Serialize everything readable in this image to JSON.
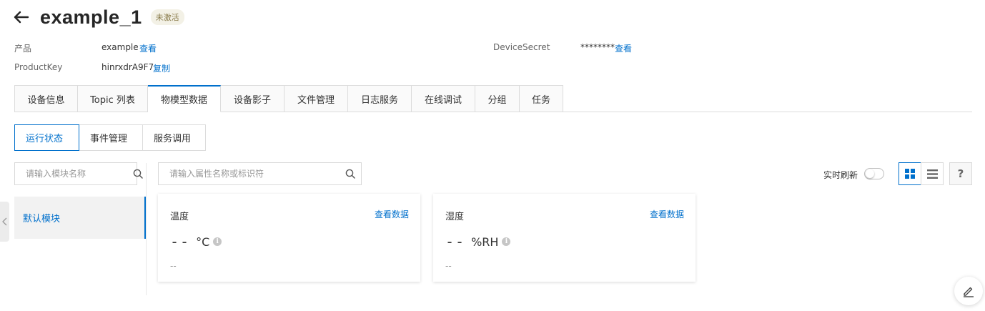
{
  "header": {
    "title": "example_1",
    "status_badge": "未激活"
  },
  "info": {
    "product_label": "产品",
    "product_value": "example",
    "product_link": "查看",
    "productkey_label": "ProductKey",
    "productkey_value": "hinrxdrA9F7",
    "productkey_link": "复制",
    "devicesecret_label": "DeviceSecret",
    "devicesecret_value": "********",
    "devicesecret_link": "查看"
  },
  "main_tabs": [
    {
      "label": "设备信息",
      "active": false
    },
    {
      "label": "Topic 列表",
      "active": false
    },
    {
      "label": "物模型数据",
      "active": true
    },
    {
      "label": "设备影子",
      "active": false
    },
    {
      "label": "文件管理",
      "active": false
    },
    {
      "label": "日志服务",
      "active": false
    },
    {
      "label": "在线调试",
      "active": false
    },
    {
      "label": "分组",
      "active": false
    },
    {
      "label": "任务",
      "active": false
    }
  ],
  "sub_tabs": [
    {
      "label": "运行状态",
      "active": true
    },
    {
      "label": "事件管理",
      "active": false
    },
    {
      "label": "服务调用",
      "active": false
    }
  ],
  "module_search": {
    "placeholder": "请输入模块名称"
  },
  "property_search": {
    "placeholder": "请输入属性名称或标识符"
  },
  "modules": [
    {
      "label": "默认模块",
      "active": true
    }
  ],
  "toolbar": {
    "realtime_refresh_label": "实时刷新",
    "realtime_refresh_on": false,
    "help_label": "?"
  },
  "cards": [
    {
      "title": "温度",
      "link": "查看数据",
      "value": "--",
      "unit": "°C",
      "time": "--"
    },
    {
      "title": "湿度",
      "link": "查看数据",
      "value": "--",
      "unit": "%RH",
      "time": "--"
    }
  ],
  "colors": {
    "accent": "#0070cc",
    "border": "#dcdcdc",
    "badge_bg": "#f3f1e6"
  }
}
